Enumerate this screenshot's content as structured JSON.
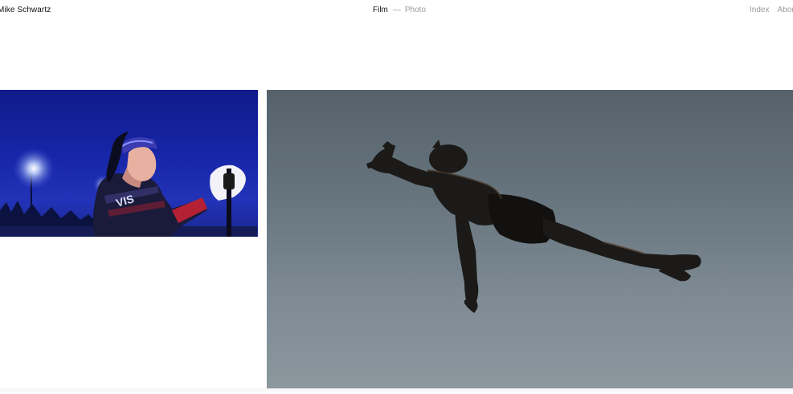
{
  "header": {
    "site_name": "Mike Schwartz",
    "nav_center": {
      "film": "Film",
      "separator": "—",
      "photo": "Photo"
    },
    "nav_right": {
      "index": "Index",
      "about": "About"
    }
  },
  "colors": {
    "active_link": "#111111",
    "inactive_link": "#9a9a9a",
    "background": "#ffffff"
  }
}
